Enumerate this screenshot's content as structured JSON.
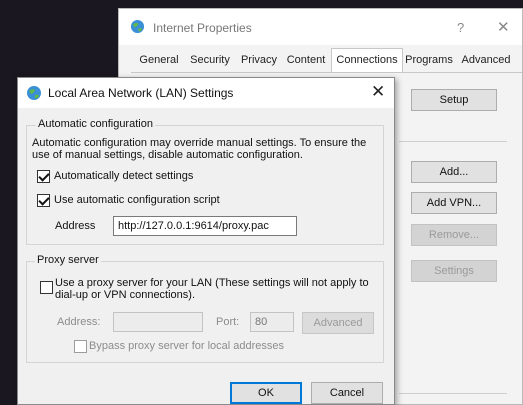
{
  "internet_properties": {
    "title": "Internet Properties",
    "help_glyph": "?",
    "close_glyph": "✕",
    "tabs": [
      {
        "label": "General"
      },
      {
        "label": "Security"
      },
      {
        "label": "Privacy"
      },
      {
        "label": "Content"
      },
      {
        "label": "Connections",
        "selected": true
      },
      {
        "label": "Programs"
      },
      {
        "label": "Advanced"
      }
    ],
    "buttons": {
      "setup": "Setup",
      "add": "Add...",
      "add_vpn": "Add VPN...",
      "remove": "Remove...",
      "settings": "Settings"
    }
  },
  "lan_dialog": {
    "title": "Local Area Network (LAN) Settings",
    "close_glyph": "✕",
    "auto_config": {
      "legend": "Automatic configuration",
      "description_line1": "Automatic configuration may override manual settings.  To ensure the",
      "description_line2": "use of manual settings, disable automatic configuration.",
      "auto_detect": {
        "label": "Automatically detect settings",
        "checked": true
      },
      "use_script": {
        "label": "Use automatic configuration script",
        "checked": true
      },
      "address_label": "Address",
      "address_value": "http://127.0.0.1:9614/proxy.pac"
    },
    "proxy_server": {
      "legend": "Proxy server",
      "use_proxy_line1": "Use a proxy server for your LAN (These settings will not apply to",
      "use_proxy_line2": "dial-up or VPN connections).",
      "use_proxy_checked": false,
      "address_label": "Address:",
      "address_value": "",
      "port_label": "Port:",
      "port_value": "80",
      "advanced_label": "Advanced",
      "bypass_label": "Bypass proxy server for local addresses",
      "bypass_checked": false
    },
    "ok_label": "OK",
    "cancel_label": "Cancel"
  },
  "colors": {
    "desktop": "#1b1720",
    "dialog_bg": "#f0f0f0",
    "default_button_border": "#0078d7"
  }
}
